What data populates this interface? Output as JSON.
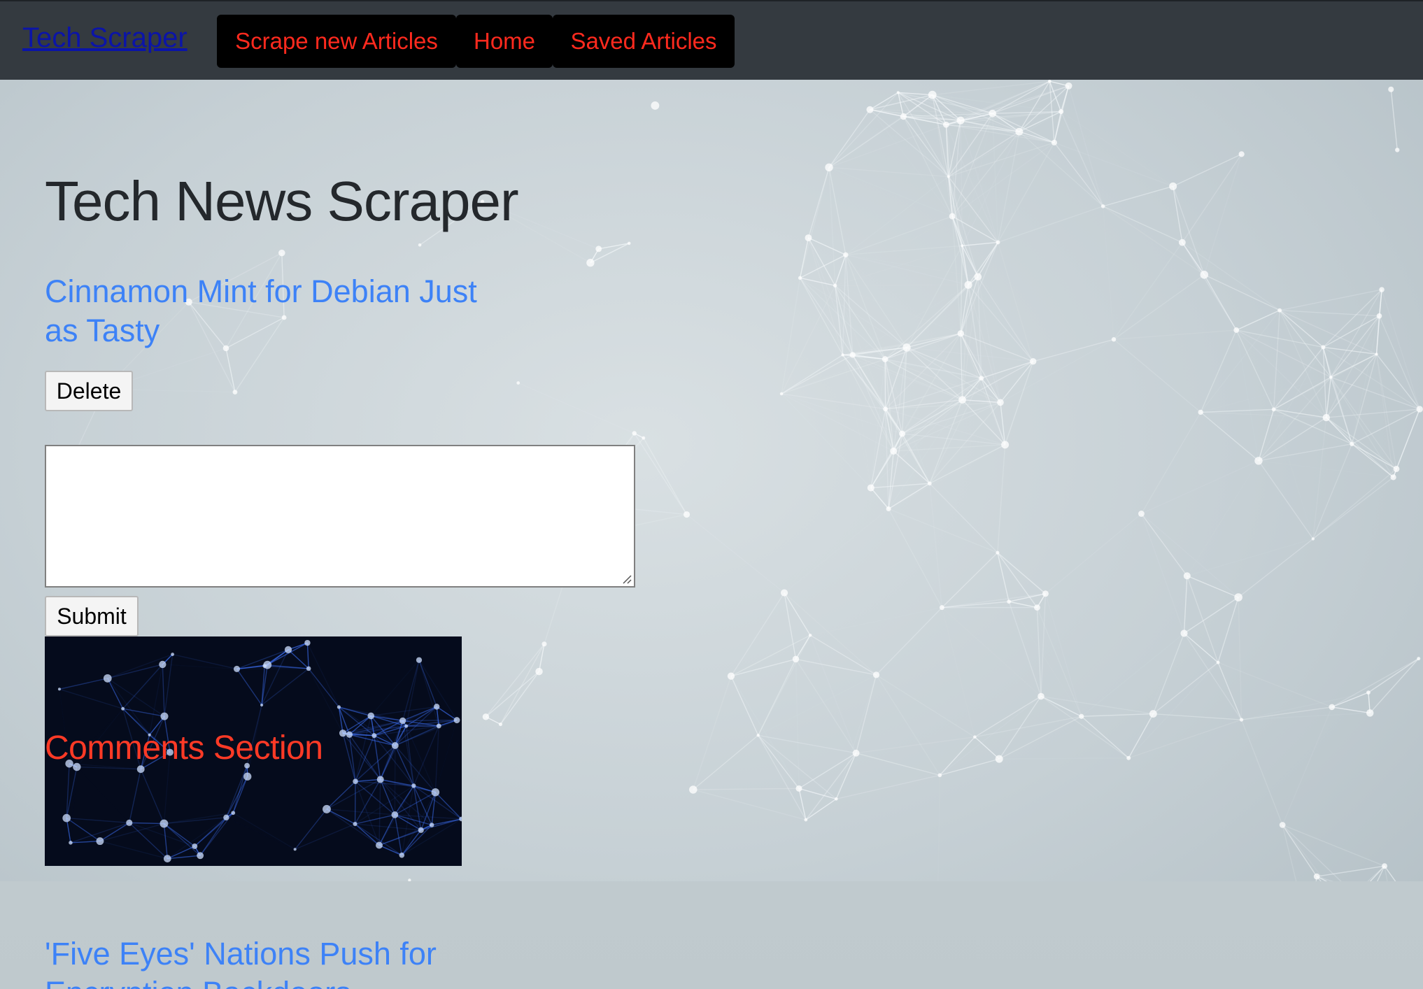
{
  "navbar": {
    "brand": "Tech Scraper",
    "items": [
      {
        "label": "Scrape new Articles"
      },
      {
        "label": "Home"
      },
      {
        "label": "Saved Articles"
      }
    ]
  },
  "main": {
    "title": "Tech News Scraper",
    "articles": [
      {
        "title": "Cinnamon Mint for Debian Just as Tasty",
        "delete_label": "Delete",
        "comment_value": "",
        "submit_label": "Submit",
        "comments_heading": "Comments Section"
      },
      {
        "title": "'Five Eyes' Nations Push for Encryption Backdoors"
      }
    ]
  },
  "colors": {
    "navbar_bg": "#343a40",
    "nav_button_bg": "#000000",
    "nav_button_text": "#ff2a1e",
    "brand_link": "#0b14a8",
    "article_link": "#3d82f7",
    "comments_heading": "#ff3a26"
  }
}
